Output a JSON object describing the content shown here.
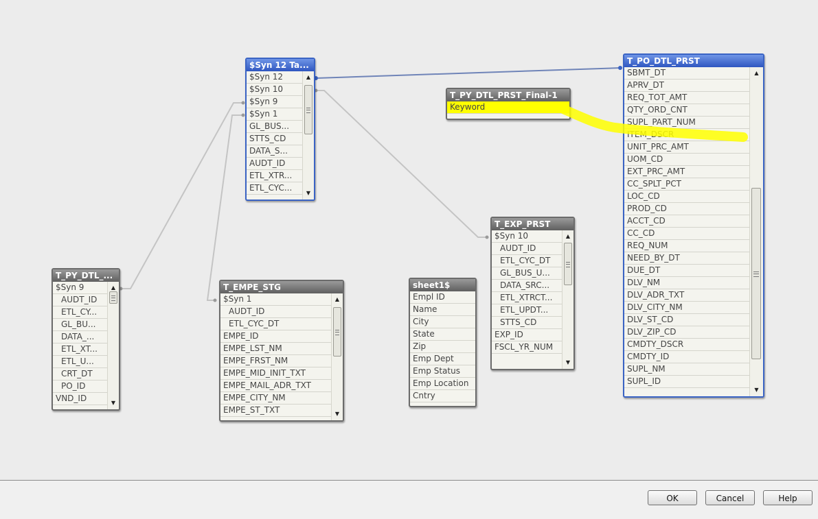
{
  "tables": {
    "syn12": {
      "title": "$Syn 12 Ta...",
      "fields": [
        "$Syn 12",
        "$Syn 10",
        "$Syn 9",
        "$Syn 1",
        "GL_BUS...",
        "STTS_CD",
        "DATA_S...",
        "AUDT_ID",
        "ETL_XTR...",
        "ETL_CYC..."
      ]
    },
    "po_dtl_prst": {
      "title": "T_PO_DTL_PRST",
      "fields": [
        "SBMT_DT",
        "APRV_DT",
        "REQ_TOT_AMT",
        "QTY_ORD_CNT",
        "SUPL_PART_NUM",
        "ITEM_DSCR",
        "UNIT_PRC_AMT",
        "UOM_CD",
        "EXT_PRC_AMT",
        "CC_SPLT_PCT",
        "LOC_CD",
        "PROD_CD",
        "ACCT_CD",
        "CC_CD",
        "REQ_NUM",
        "NEED_BY_DT",
        "DUE_DT",
        "DLV_NM",
        "DLV_ADR_TXT",
        "DLV_CITY_NM",
        "DLV_ST_CD",
        "DLV_ZIP_CD",
        "CMDTY_DSCR",
        "CMDTY_ID",
        "SUPL_NM",
        "SUPL_ID"
      ]
    },
    "py_dtl_final": {
      "title": "T_PY_DTL_PRST_Final-1",
      "fields": [
        "Keyword"
      ]
    },
    "exp_prst": {
      "title": "T_EXP_PRST",
      "fields": [
        "$Syn 10",
        "AUDT_ID",
        "ETL_CYC_DT",
        "GL_BUS_U...",
        "DATA_SRC...",
        "ETL_XTRCT...",
        "ETL_UPDT...",
        "STTS_CD",
        "EXP_ID",
        "FSCL_YR_NUM"
      ]
    },
    "py_dtl": {
      "title": "T_PY_DTL_...",
      "fields": [
        "$Syn 9",
        "AUDT_ID",
        "ETL_CY...",
        "GL_BU...",
        "DATA_...",
        "ETL_XT...",
        "ETL_U...",
        "CRT_DT",
        "PO_ID",
        "VND_ID"
      ]
    },
    "empe_stg": {
      "title": "T_EMPE_STG",
      "fields": [
        "$Syn 1",
        "AUDT_ID",
        "ETL_CYC_DT",
        "EMPE_ID",
        "EMPE_LST_NM",
        "EMPE_FRST_NM",
        "EMPE_MID_INIT_TXT",
        "EMPE_MAIL_ADR_TXT",
        "EMPE_CITY_NM",
        "EMPE_ST_TXT"
      ]
    },
    "sheet1": {
      "title": "sheet1$",
      "fields": [
        "Empl ID",
        "Name",
        "City",
        "State",
        "Zip",
        "Emp Dept",
        "Emp Status",
        "Emp Location",
        "Cntry"
      ]
    }
  },
  "footer": {
    "ok_label": "OK",
    "cancel_label": "Cancel",
    "help_label": "Help"
  },
  "colors": {
    "selected_header": "#3a63c4",
    "header": "#6b6b6b",
    "link_line": "#c4c4c4",
    "selected_link": "#6f84b8",
    "highlight": "#ffff00"
  }
}
